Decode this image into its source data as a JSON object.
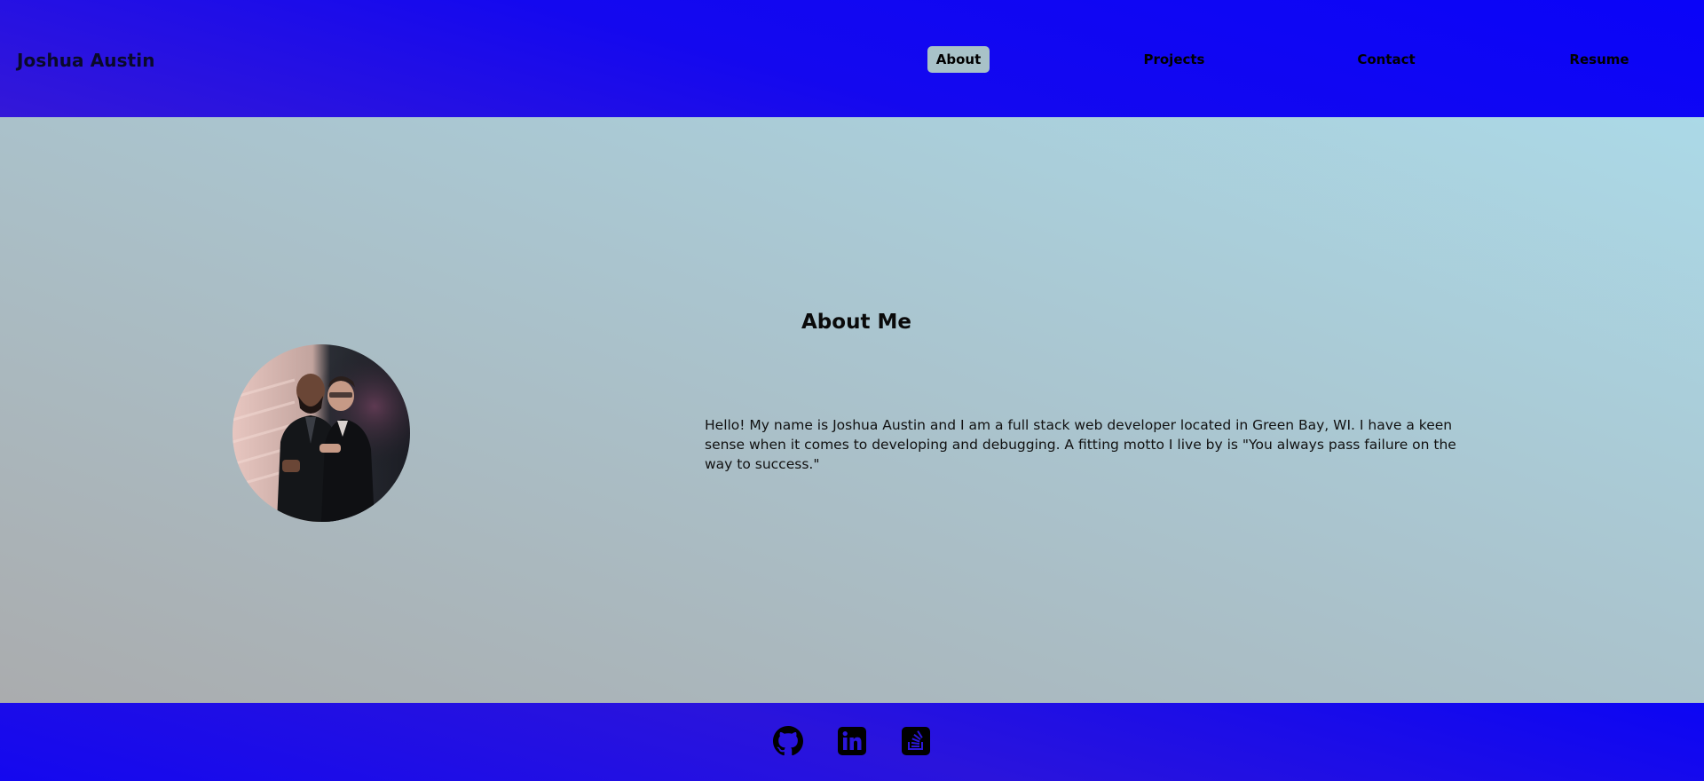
{
  "header": {
    "brand": "Joshua Austin",
    "nav": [
      {
        "label": "About",
        "active": true
      },
      {
        "label": "Projects",
        "active": false
      },
      {
        "label": "Contact",
        "active": false
      },
      {
        "label": "Resume",
        "active": false
      }
    ]
  },
  "about": {
    "title": "About Me",
    "text": "Hello! My name is Joshua Austin and I am a full stack web developer located in Green Bay, WI. I have a keen sense when it comes to developing and debugging. A fitting motto I live by is \"You always pass failure on the way to success.\""
  },
  "footer": {
    "links": [
      {
        "icon": "github-icon"
      },
      {
        "icon": "linkedin-icon"
      },
      {
        "icon": "stackoverflow-icon"
      }
    ]
  },
  "colors": {
    "header_bg": "#0a04f8",
    "accent_active_nav": "#a8c2c8",
    "main_bg_top": "#abd9e7",
    "main_bg_bottom": "#aaacae"
  }
}
